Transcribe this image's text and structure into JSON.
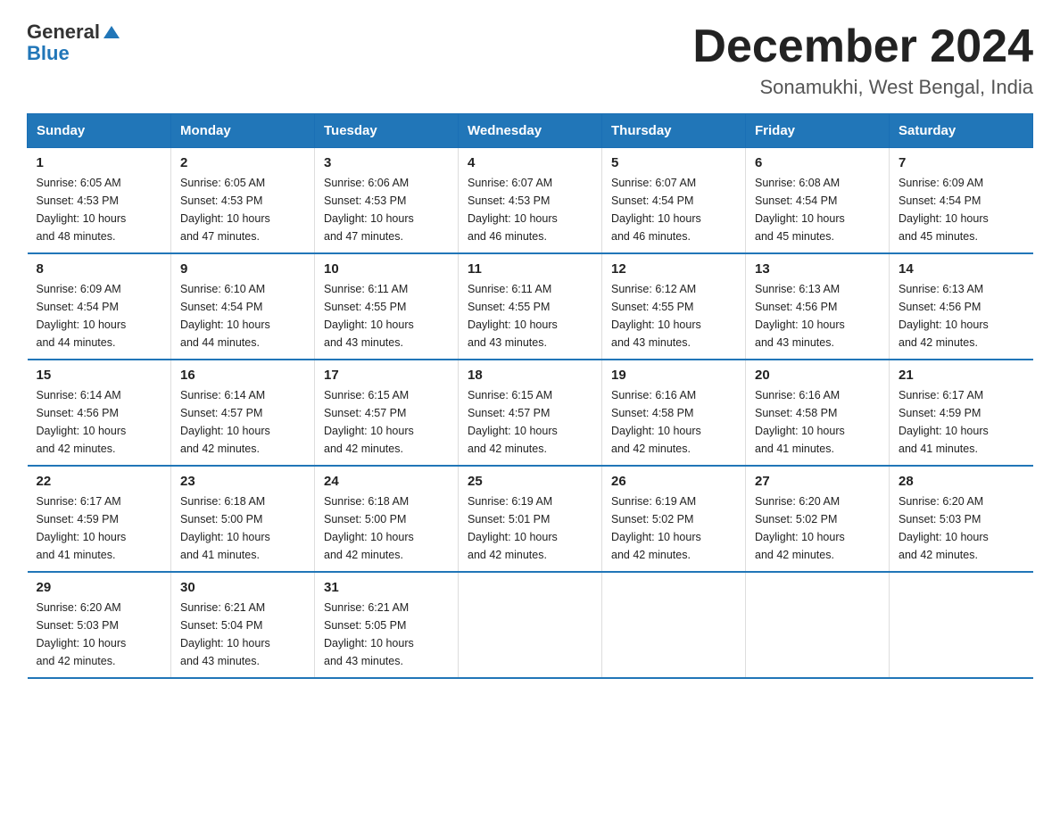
{
  "header": {
    "logo_general": "General",
    "logo_blue": "Blue",
    "month_title": "December 2024",
    "location": "Sonamukhi, West Bengal, India"
  },
  "calendar": {
    "weekdays": [
      "Sunday",
      "Monday",
      "Tuesday",
      "Wednesday",
      "Thursday",
      "Friday",
      "Saturday"
    ],
    "weeks": [
      [
        {
          "day": "1",
          "sunrise": "6:05 AM",
          "sunset": "4:53 PM",
          "daylight": "10 hours and 48 minutes."
        },
        {
          "day": "2",
          "sunrise": "6:05 AM",
          "sunset": "4:53 PM",
          "daylight": "10 hours and 47 minutes."
        },
        {
          "day": "3",
          "sunrise": "6:06 AM",
          "sunset": "4:53 PM",
          "daylight": "10 hours and 47 minutes."
        },
        {
          "day": "4",
          "sunrise": "6:07 AM",
          "sunset": "4:53 PM",
          "daylight": "10 hours and 46 minutes."
        },
        {
          "day": "5",
          "sunrise": "6:07 AM",
          "sunset": "4:54 PM",
          "daylight": "10 hours and 46 minutes."
        },
        {
          "day": "6",
          "sunrise": "6:08 AM",
          "sunset": "4:54 PM",
          "daylight": "10 hours and 45 minutes."
        },
        {
          "day": "7",
          "sunrise": "6:09 AM",
          "sunset": "4:54 PM",
          "daylight": "10 hours and 45 minutes."
        }
      ],
      [
        {
          "day": "8",
          "sunrise": "6:09 AM",
          "sunset": "4:54 PM",
          "daylight": "10 hours and 44 minutes."
        },
        {
          "day": "9",
          "sunrise": "6:10 AM",
          "sunset": "4:54 PM",
          "daylight": "10 hours and 44 minutes."
        },
        {
          "day": "10",
          "sunrise": "6:11 AM",
          "sunset": "4:55 PM",
          "daylight": "10 hours and 43 minutes."
        },
        {
          "day": "11",
          "sunrise": "6:11 AM",
          "sunset": "4:55 PM",
          "daylight": "10 hours and 43 minutes."
        },
        {
          "day": "12",
          "sunrise": "6:12 AM",
          "sunset": "4:55 PM",
          "daylight": "10 hours and 43 minutes."
        },
        {
          "day": "13",
          "sunrise": "6:13 AM",
          "sunset": "4:56 PM",
          "daylight": "10 hours and 43 minutes."
        },
        {
          "day": "14",
          "sunrise": "6:13 AM",
          "sunset": "4:56 PM",
          "daylight": "10 hours and 42 minutes."
        }
      ],
      [
        {
          "day": "15",
          "sunrise": "6:14 AM",
          "sunset": "4:56 PM",
          "daylight": "10 hours and 42 minutes."
        },
        {
          "day": "16",
          "sunrise": "6:14 AM",
          "sunset": "4:57 PM",
          "daylight": "10 hours and 42 minutes."
        },
        {
          "day": "17",
          "sunrise": "6:15 AM",
          "sunset": "4:57 PM",
          "daylight": "10 hours and 42 minutes."
        },
        {
          "day": "18",
          "sunrise": "6:15 AM",
          "sunset": "4:57 PM",
          "daylight": "10 hours and 42 minutes."
        },
        {
          "day": "19",
          "sunrise": "6:16 AM",
          "sunset": "4:58 PM",
          "daylight": "10 hours and 42 minutes."
        },
        {
          "day": "20",
          "sunrise": "6:16 AM",
          "sunset": "4:58 PM",
          "daylight": "10 hours and 41 minutes."
        },
        {
          "day": "21",
          "sunrise": "6:17 AM",
          "sunset": "4:59 PM",
          "daylight": "10 hours and 41 minutes."
        }
      ],
      [
        {
          "day": "22",
          "sunrise": "6:17 AM",
          "sunset": "4:59 PM",
          "daylight": "10 hours and 41 minutes."
        },
        {
          "day": "23",
          "sunrise": "6:18 AM",
          "sunset": "5:00 PM",
          "daylight": "10 hours and 41 minutes."
        },
        {
          "day": "24",
          "sunrise": "6:18 AM",
          "sunset": "5:00 PM",
          "daylight": "10 hours and 42 minutes."
        },
        {
          "day": "25",
          "sunrise": "6:19 AM",
          "sunset": "5:01 PM",
          "daylight": "10 hours and 42 minutes."
        },
        {
          "day": "26",
          "sunrise": "6:19 AM",
          "sunset": "5:02 PM",
          "daylight": "10 hours and 42 minutes."
        },
        {
          "day": "27",
          "sunrise": "6:20 AM",
          "sunset": "5:02 PM",
          "daylight": "10 hours and 42 minutes."
        },
        {
          "day": "28",
          "sunrise": "6:20 AM",
          "sunset": "5:03 PM",
          "daylight": "10 hours and 42 minutes."
        }
      ],
      [
        {
          "day": "29",
          "sunrise": "6:20 AM",
          "sunset": "5:03 PM",
          "daylight": "10 hours and 42 minutes."
        },
        {
          "day": "30",
          "sunrise": "6:21 AM",
          "sunset": "5:04 PM",
          "daylight": "10 hours and 43 minutes."
        },
        {
          "day": "31",
          "sunrise": "6:21 AM",
          "sunset": "5:05 PM",
          "daylight": "10 hours and 43 minutes."
        },
        null,
        null,
        null,
        null
      ]
    ],
    "labels": {
      "sunrise": "Sunrise:",
      "sunset": "Sunset:",
      "daylight": "Daylight:"
    }
  }
}
